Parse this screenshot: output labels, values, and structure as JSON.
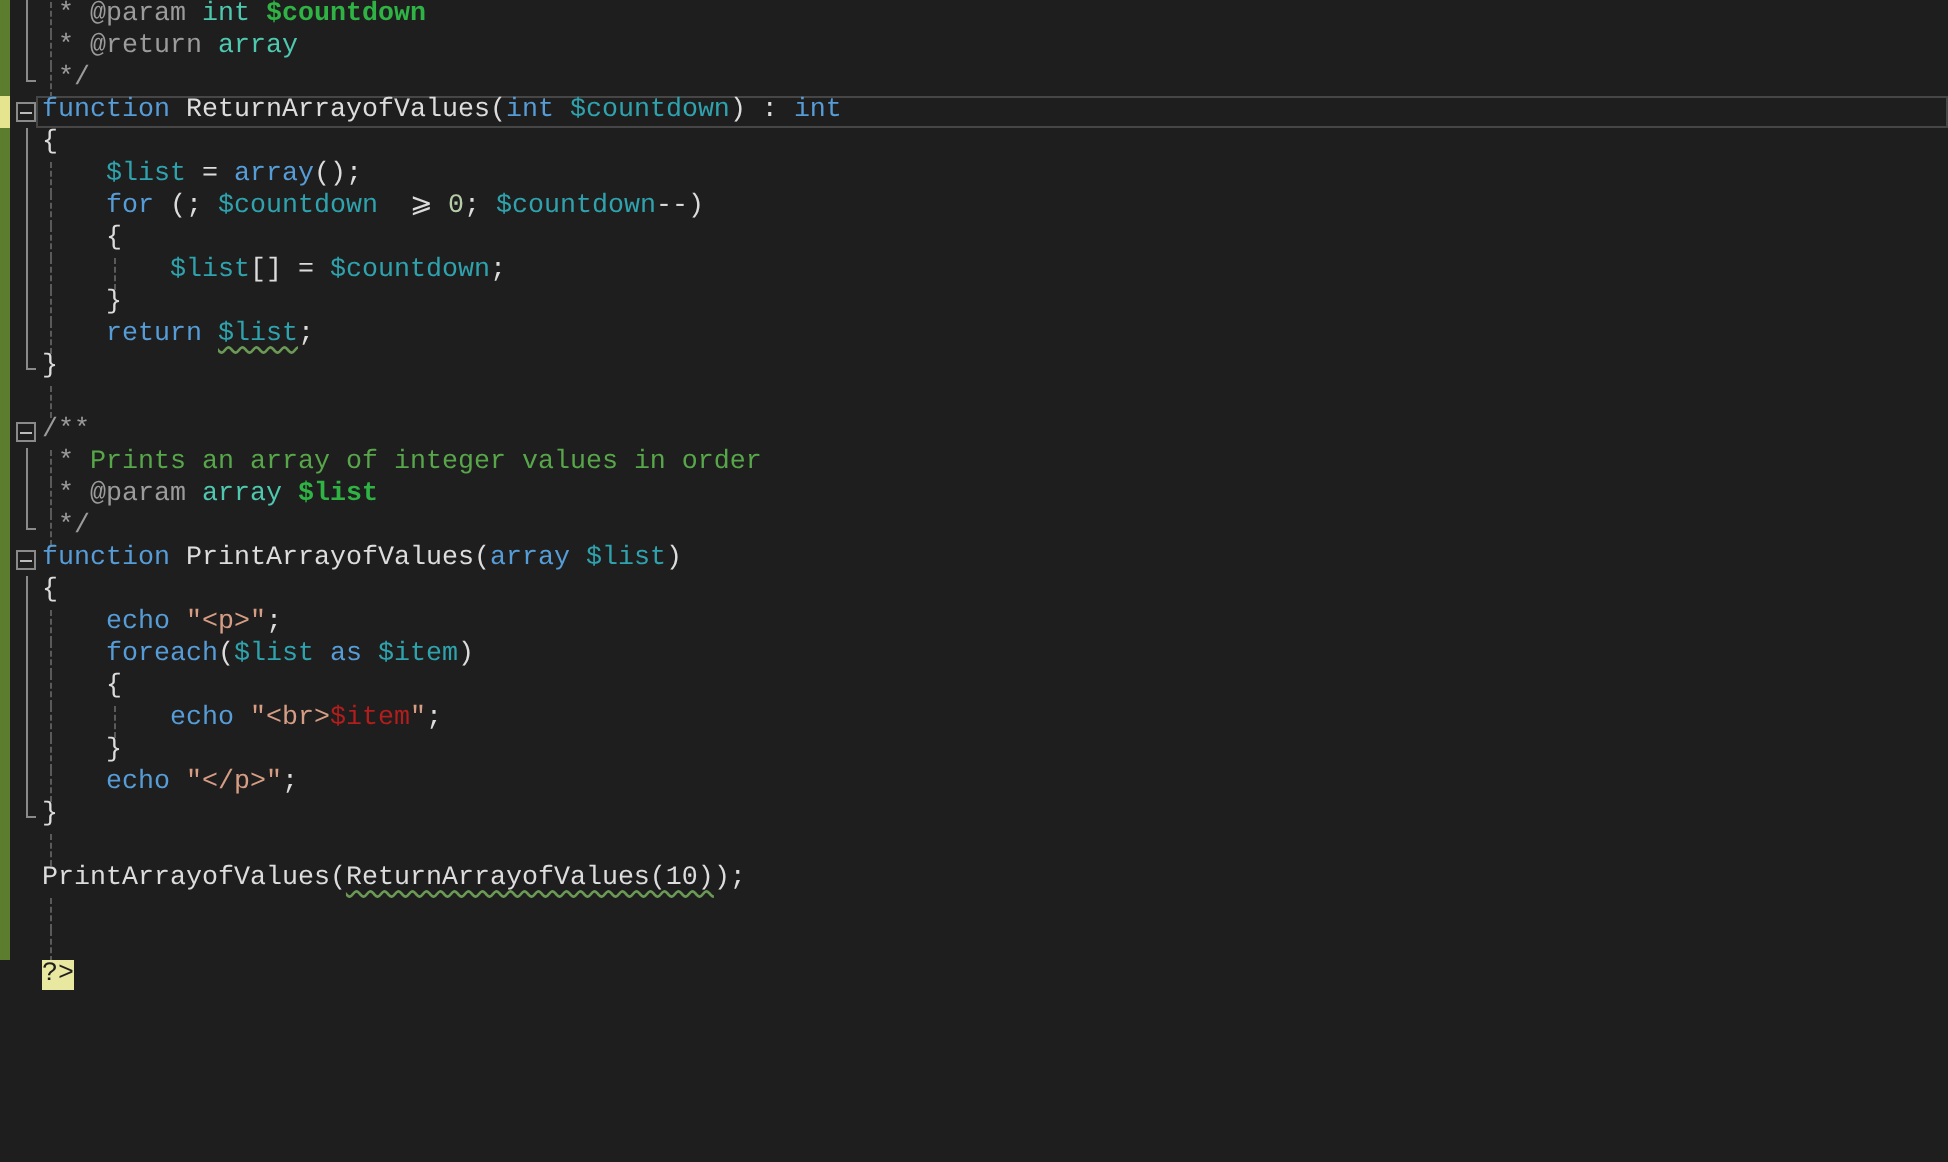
{
  "editor": {
    "lines": [
      {
        "modified": true,
        "unsaved": false,
        "in_region": true,
        "selected": false,
        "tokens": [
          {
            "text": " * @param ",
            "kind": "doc-mark"
          },
          {
            "text": "int ",
            "kind": "doc-type"
          },
          {
            "text": "$countdown",
            "kind": "doc-var"
          }
        ]
      },
      {
        "modified": true,
        "unsaved": false,
        "in_region": true,
        "selected": false,
        "tokens": [
          {
            "text": " * @return ",
            "kind": "doc-mark"
          },
          {
            "text": "array",
            "kind": "doc-type"
          }
        ]
      },
      {
        "modified": true,
        "unsaved": false,
        "region_end": true,
        "selected": false,
        "tokens": [
          {
            "text": " */",
            "kind": "doc-mark"
          }
        ]
      },
      {
        "modified": true,
        "unsaved": true,
        "collapse_toggle": true,
        "selected": true,
        "tokens": [
          {
            "text": "function ",
            "kind": "keyword"
          },
          {
            "text": "ReturnArrayofValues(",
            "kind": "plain"
          },
          {
            "text": "int ",
            "kind": "keyword"
          },
          {
            "text": "$countdown",
            "kind": "var"
          },
          {
            "text": ") : ",
            "kind": "plain"
          },
          {
            "text": "int",
            "kind": "keyword"
          }
        ]
      },
      {
        "modified": true,
        "unsaved": false,
        "in_region": true,
        "selected": false,
        "tokens": [
          {
            "text": "{",
            "kind": "plain"
          }
        ]
      },
      {
        "modified": true,
        "unsaved": false,
        "in_region": true,
        "selected": false,
        "tokens": [
          {
            "text": "    $list",
            "kind": "var"
          },
          {
            "text": " = ",
            "kind": "plain"
          },
          {
            "text": "array",
            "kind": "keyword"
          },
          {
            "text": "();",
            "kind": "plain"
          }
        ]
      },
      {
        "modified": true,
        "unsaved": false,
        "in_region": true,
        "selected": false,
        "tokens": [
          {
            "text": "    for",
            "kind": "keyword"
          },
          {
            "text": " (; ",
            "kind": "plain"
          },
          {
            "text": "$countdown",
            "kind": "var"
          },
          {
            "text": "  ⩾ ",
            "kind": "plain"
          },
          {
            "text": "0",
            "kind": "number"
          },
          {
            "text": "; ",
            "kind": "plain"
          },
          {
            "text": "$countdown",
            "kind": "var"
          },
          {
            "text": "--)",
            "kind": "plain"
          }
        ]
      },
      {
        "modified": true,
        "unsaved": false,
        "in_region": true,
        "selected": false,
        "tokens": [
          {
            "text": "    {",
            "kind": "plain"
          }
        ]
      },
      {
        "modified": true,
        "unsaved": false,
        "in_region": true,
        "selected": false,
        "tokens": [
          {
            "text": "        $list",
            "kind": "var"
          },
          {
            "text": "[] = ",
            "kind": "plain"
          },
          {
            "text": "$countdown",
            "kind": "var"
          },
          {
            "text": ";",
            "kind": "plain"
          }
        ]
      },
      {
        "modified": true,
        "unsaved": false,
        "in_region": true,
        "selected": false,
        "tokens": [
          {
            "text": "    }",
            "kind": "plain"
          }
        ]
      },
      {
        "modified": true,
        "unsaved": false,
        "in_region": true,
        "selected": false,
        "tokens": [
          {
            "text": "    return ",
            "kind": "keyword"
          },
          {
            "text": "$list",
            "kind": "var",
            "squiggle": true
          },
          {
            "text": ";",
            "kind": "plain"
          }
        ]
      },
      {
        "modified": true,
        "unsaved": false,
        "region_end": true,
        "selected": false,
        "tokens": [
          {
            "text": "}",
            "kind": "plain"
          }
        ]
      },
      {
        "modified": true,
        "unsaved": false,
        "selected": false
      },
      {
        "modified": true,
        "unsaved": false,
        "collapse_toggle": true,
        "selected": false,
        "tokens": [
          {
            "text": "/**",
            "kind": "doc-mark"
          }
        ]
      },
      {
        "modified": true,
        "unsaved": false,
        "in_region": true,
        "selected": false,
        "tokens": [
          {
            "text": " * ",
            "kind": "doc-mark"
          },
          {
            "text": "Prints an array of integer values in order",
            "kind": "comment"
          }
        ]
      },
      {
        "modified": true,
        "unsaved": false,
        "in_region": true,
        "selected": false,
        "tokens": [
          {
            "text": " * @param ",
            "kind": "doc-mark"
          },
          {
            "text": "array ",
            "kind": "doc-type"
          },
          {
            "text": "$list",
            "kind": "doc-var"
          }
        ]
      },
      {
        "modified": true,
        "unsaved": false,
        "region_end": true,
        "selected": false,
        "tokens": [
          {
            "text": " */",
            "kind": "doc-mark"
          }
        ]
      },
      {
        "modified": true,
        "unsaved": false,
        "collapse_toggle": true,
        "selected": false,
        "tokens": [
          {
            "text": "function ",
            "kind": "keyword"
          },
          {
            "text": "PrintArrayofValues(",
            "kind": "plain"
          },
          {
            "text": "array ",
            "kind": "keyword"
          },
          {
            "text": "$list",
            "kind": "var"
          },
          {
            "text": ")",
            "kind": "plain"
          }
        ]
      },
      {
        "modified": true,
        "unsaved": false,
        "in_region": true,
        "selected": false,
        "tokens": [
          {
            "text": "{",
            "kind": "plain"
          }
        ]
      },
      {
        "modified": true,
        "unsaved": false,
        "in_region": true,
        "selected": false,
        "tokens": [
          {
            "text": "    echo ",
            "kind": "keyword"
          },
          {
            "text": "\"<p>\"",
            "kind": "string"
          },
          {
            "text": ";",
            "kind": "plain"
          }
        ]
      },
      {
        "modified": true,
        "unsaved": false,
        "in_region": true,
        "selected": false,
        "tokens": [
          {
            "text": "    foreach",
            "kind": "keyword"
          },
          {
            "text": "(",
            "kind": "plain"
          },
          {
            "text": "$list",
            "kind": "var"
          },
          {
            "text": " as ",
            "kind": "keyword"
          },
          {
            "text": "$item",
            "kind": "var"
          },
          {
            "text": ")",
            "kind": "plain"
          }
        ]
      },
      {
        "modified": true,
        "unsaved": false,
        "in_region": true,
        "selected": false,
        "tokens": [
          {
            "text": "    {",
            "kind": "plain"
          }
        ]
      },
      {
        "modified": true,
        "unsaved": false,
        "in_region": true,
        "selected": false,
        "tokens": [
          {
            "text": "        echo ",
            "kind": "keyword"
          },
          {
            "text": "\"<br>",
            "kind": "string"
          },
          {
            "text": "$item",
            "kind": "string-var"
          },
          {
            "text": "\"",
            "kind": "string"
          },
          {
            "text": ";",
            "kind": "plain"
          }
        ]
      },
      {
        "modified": true,
        "unsaved": false,
        "in_region": true,
        "selected": false,
        "tokens": [
          {
            "text": "    }",
            "kind": "plain"
          }
        ]
      },
      {
        "modified": true,
        "unsaved": false,
        "in_region": true,
        "selected": false,
        "tokens": [
          {
            "text": "    echo ",
            "kind": "keyword"
          },
          {
            "text": "\"</p>\"",
            "kind": "string"
          },
          {
            "text": ";",
            "kind": "plain"
          }
        ]
      },
      {
        "modified": true,
        "unsaved": false,
        "region_end": true,
        "selected": false,
        "tokens": [
          {
            "text": "}",
            "kind": "plain"
          }
        ]
      },
      {
        "modified": true,
        "unsaved": false,
        "selected": false
      },
      {
        "modified": true,
        "unsaved": false,
        "selected": false,
        "tokens": [
          {
            "text": "PrintArrayofValues(",
            "kind": "plain"
          },
          {
            "text": "ReturnArrayofValues(10)",
            "kind": "plain",
            "squiggle": true
          },
          {
            "text": ");",
            "kind": "plain"
          }
        ]
      },
      {
        "modified": true,
        "unsaved": false,
        "selected": false
      },
      {
        "modified": true,
        "unsaved": false,
        "selected": false
      },
      {
        "modified": false,
        "unsaved": false,
        "selected": false,
        "tokens": [
          {
            "text": "?>",
            "kind": "php-tag"
          }
        ]
      }
    ]
  }
}
